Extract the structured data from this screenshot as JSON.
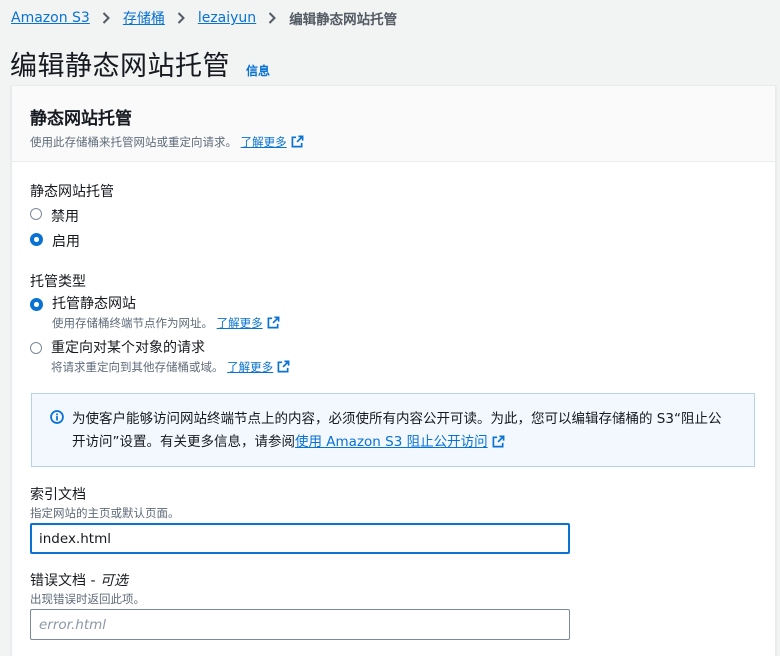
{
  "breadcrumb": {
    "items": [
      "Amazon S3",
      "存储桶",
      "lezaiyun"
    ],
    "current": "编辑静态网站托管"
  },
  "page": {
    "title": "编辑静态网站托管",
    "info_link": "信息"
  },
  "panel": {
    "title": "静态网站托管",
    "description": "使用此存储桶来托管网站或重定向请求。",
    "learn_more": "了解更多"
  },
  "hosting": {
    "label": "静态网站托管",
    "options": [
      {
        "label": "禁用",
        "checked": false
      },
      {
        "label": "启用",
        "checked": true
      }
    ]
  },
  "hosting_type": {
    "label": "托管类型",
    "options": [
      {
        "label": "托管静态网站",
        "description": "使用存储桶终端节点作为网址。",
        "learn_more": "了解更多",
        "checked": true
      },
      {
        "label": "重定向对某个对象的请求",
        "description": "将请求重定向到其他存储桶或域。",
        "learn_more": "了解更多",
        "checked": false
      }
    ]
  },
  "alert": {
    "text": "为使客户能够访问网站终端节点上的内容，必须使所有内容公开可读。为此，您可以编辑存储桶的 S3“阻止公开访问”设置。有关更多信息，请参阅",
    "link": "使用 Amazon S3 阻止公开访问"
  },
  "index_document": {
    "label": "索引文档",
    "hint": "指定网站的主页或默认页面。",
    "value": "index.html"
  },
  "error_document": {
    "label": "错误文档",
    "optional": "可选",
    "hint": "出现错误时返回此项。",
    "placeholder": "error.html"
  },
  "colors": {
    "link": "#0972d3",
    "text": "#16191f",
    "muted": "#5f6b7a",
    "info_bg": "#f2f8fd"
  },
  "icons": [
    "chevron-right-icon",
    "external-link-icon",
    "info-icon"
  ]
}
